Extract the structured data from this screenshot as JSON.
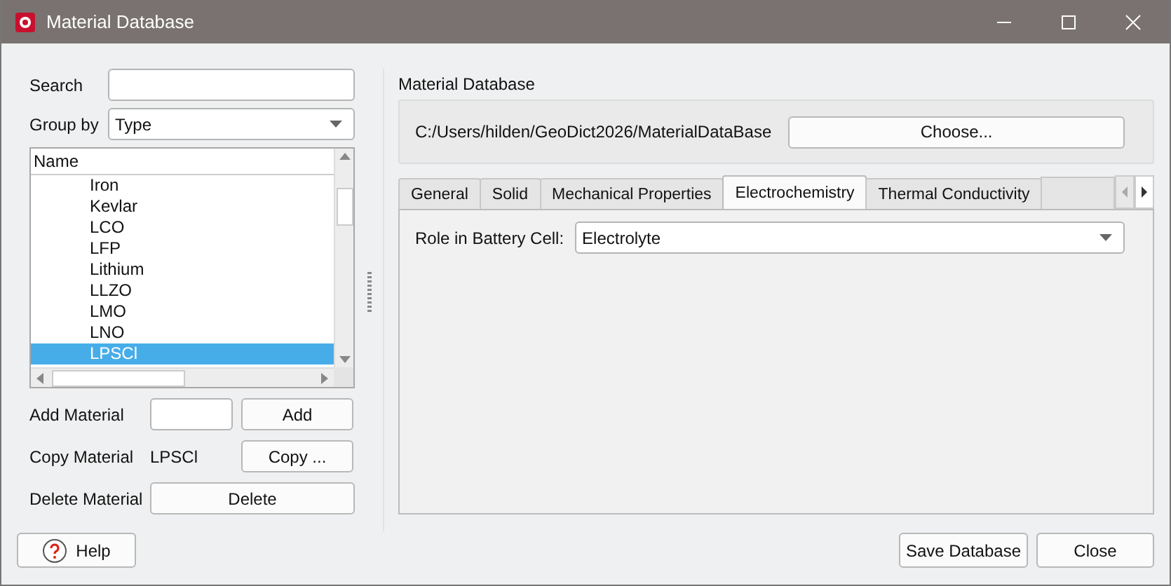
{
  "window": {
    "title": "Material Database"
  },
  "search": {
    "label": "Search"
  },
  "group_by": {
    "label": "Group by",
    "value": "Type"
  },
  "list": {
    "header": "Name",
    "items": [
      {
        "label": "Iron",
        "selected": false
      },
      {
        "label": "Kevlar",
        "selected": false
      },
      {
        "label": "LCO",
        "selected": false
      },
      {
        "label": "LFP",
        "selected": false
      },
      {
        "label": "Lithium",
        "selected": false
      },
      {
        "label": "LLZO",
        "selected": false
      },
      {
        "label": "LMO",
        "selected": false
      },
      {
        "label": "LNO",
        "selected": false
      },
      {
        "label": "LPSCl",
        "selected": true
      }
    ]
  },
  "add": {
    "label": "Add Material",
    "button": "Add"
  },
  "copy": {
    "label": "Copy Material",
    "value": "LPSCl",
    "button": "Copy ..."
  },
  "delete": {
    "label": "Delete Material",
    "button": "Delete"
  },
  "database": {
    "label": "Material Database",
    "path": "C:/Users/hilden/GeoDict2026/MaterialDataBase",
    "button": "Choose..."
  },
  "tabs": [
    {
      "label": "General",
      "selected": false
    },
    {
      "label": "Solid",
      "selected": false
    },
    {
      "label": "Mechanical Properties",
      "selected": false
    },
    {
      "label": "Electrochemistry",
      "selected": true
    },
    {
      "label": "Thermal Conductivity",
      "selected": false
    }
  ],
  "role": {
    "label": "Role in Battery Cell:",
    "value": "Electrolyte"
  },
  "buttons": {
    "help": "Help",
    "save": "Save Database",
    "close": "Close"
  }
}
